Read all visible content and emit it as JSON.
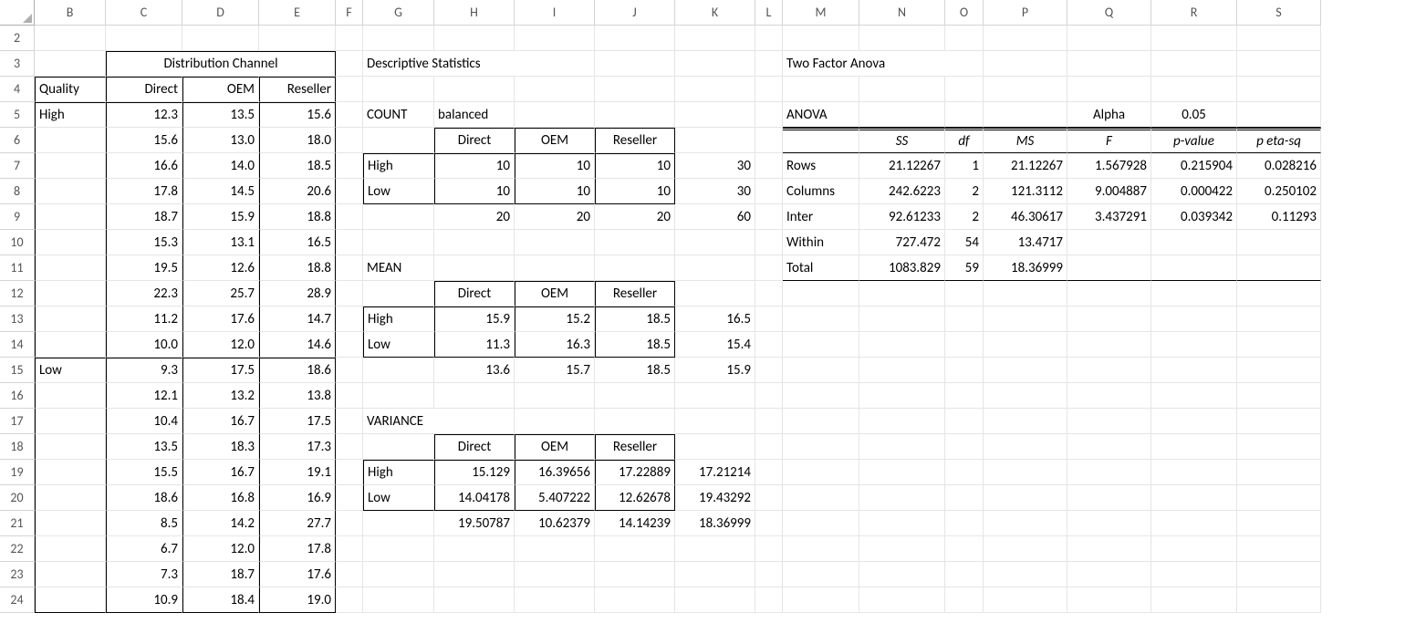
{
  "columns": [
    "B",
    "C",
    "D",
    "E",
    "F",
    "G",
    "H",
    "I",
    "J",
    "K",
    "L",
    "M",
    "N",
    "O",
    "P",
    "Q",
    "R",
    "S"
  ],
  "rowStart": 2,
  "rowEnd": 24,
  "headers": {
    "distChannel": "Distribution Channel",
    "quality": "Quality",
    "direct": "Direct",
    "oem": "OEM",
    "reseller": "Reseller",
    "high": "High",
    "low": "Low",
    "descStats": "Descriptive Statistics",
    "count": "COUNT",
    "balanced": "balanced",
    "mean": "MEAN",
    "variance": "VARIANCE",
    "twoFactor": "Two Factor Anova",
    "anova": "ANOVA",
    "alpha": "Alpha",
    "alphaVal": "0.05",
    "ss": "SS",
    "df": "df",
    "ms": "MS",
    "F": "F",
    "pvalue": "p-value",
    "petasq": "p eta-sq",
    "rows": "Rows",
    "colsLbl": "Columns",
    "inter": "Inter",
    "within": "Within",
    "total": "Total"
  },
  "data": {
    "r5": {
      "C": "12.3",
      "D": "13.5",
      "E": "15.6"
    },
    "r6": {
      "C": "15.6",
      "D": "13.0",
      "E": "18.0"
    },
    "r7": {
      "C": "16.6",
      "D": "14.0",
      "E": "18.5"
    },
    "r8": {
      "C": "17.8",
      "D": "14.5",
      "E": "20.6"
    },
    "r9": {
      "C": "18.7",
      "D": "15.9",
      "E": "18.8"
    },
    "r10": {
      "C": "15.3",
      "D": "13.1",
      "E": "16.5"
    },
    "r11": {
      "C": "19.5",
      "D": "12.6",
      "E": "18.8"
    },
    "r12": {
      "C": "22.3",
      "D": "25.7",
      "E": "28.9"
    },
    "r13": {
      "C": "11.2",
      "D": "17.6",
      "E": "14.7"
    },
    "r14": {
      "C": "10.0",
      "D": "12.0",
      "E": "14.6"
    },
    "r15": {
      "C": "9.3",
      "D": "17.5",
      "E": "18.6"
    },
    "r16": {
      "C": "12.1",
      "D": "13.2",
      "E": "13.8"
    },
    "r17": {
      "C": "10.4",
      "D": "16.7",
      "E": "17.5"
    },
    "r18": {
      "C": "13.5",
      "D": "18.3",
      "E": "17.3"
    },
    "r19": {
      "C": "15.5",
      "D": "16.7",
      "E": "19.1"
    },
    "r20": {
      "C": "18.6",
      "D": "16.8",
      "E": "16.9"
    },
    "r21": {
      "C": "8.5",
      "D": "14.2",
      "E": "27.7"
    },
    "r22": {
      "C": "6.7",
      "D": "12.0",
      "E": "17.8"
    },
    "r23": {
      "C": "7.3",
      "D": "18.7",
      "E": "17.6"
    },
    "r24": {
      "C": "10.9",
      "D": "18.4",
      "E": "19.0"
    }
  },
  "count": {
    "high": {
      "H": "10",
      "I": "10",
      "J": "10",
      "K": "30"
    },
    "low": {
      "H": "10",
      "I": "10",
      "J": "10",
      "K": "30"
    },
    "tot": {
      "H": "20",
      "I": "20",
      "J": "20",
      "K": "60"
    }
  },
  "mean": {
    "high": {
      "H": "15.9",
      "I": "15.2",
      "J": "18.5",
      "K": "16.5"
    },
    "low": {
      "H": "11.3",
      "I": "16.3",
      "J": "18.5",
      "K": "15.4"
    },
    "tot": {
      "H": "13.6",
      "I": "15.7",
      "J": "18.5",
      "K": "15.9"
    }
  },
  "variance": {
    "high": {
      "H": "15.129",
      "I": "16.39656",
      "J": "17.22889",
      "K": "17.21214"
    },
    "low": {
      "H": "14.04178",
      "I": "5.407222",
      "J": "12.62678",
      "K": "19.43292"
    },
    "tot": {
      "H": "19.50787",
      "I": "10.62379",
      "J": "14.14239",
      "K": "18.36999"
    }
  },
  "anova": {
    "rows": {
      "SS": "21.12267",
      "df": "1",
      "MS": "21.12267",
      "F": "1.567928",
      "p": "0.215904",
      "eta": "0.028216"
    },
    "columns": {
      "SS": "242.6223",
      "df": "2",
      "MS": "121.3112",
      "F": "9.004887",
      "p": "0.000422",
      "eta": "0.250102"
    },
    "inter": {
      "SS": "92.61233",
      "df": "2",
      "MS": "46.30617",
      "F": "3.437291",
      "p": "0.039342",
      "eta": "0.11293"
    },
    "within": {
      "SS": "727.472",
      "df": "54",
      "MS": "13.4717"
    },
    "total": {
      "SS": "1083.829",
      "df": "59",
      "MS": "18.36999"
    }
  }
}
